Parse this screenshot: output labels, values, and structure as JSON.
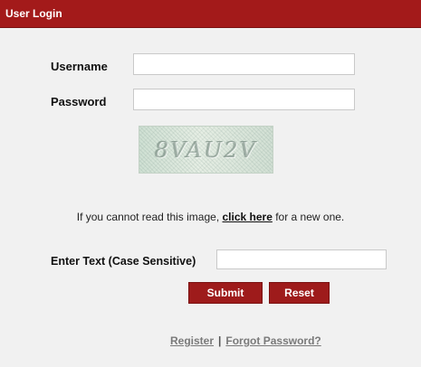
{
  "header": {
    "title": "User Login"
  },
  "form": {
    "username_label": "Username",
    "username_value": "",
    "password_label": "Password",
    "password_value": ""
  },
  "captcha": {
    "image_text": "8VAU2V",
    "note_prefix": "If you cannot read this image, ",
    "note_link": "click here",
    "note_suffix": " for a new one.",
    "enter_label": "Enter Text (Case Sensitive)",
    "enter_value": ""
  },
  "buttons": {
    "submit": "Submit",
    "reset": "Reset"
  },
  "links": {
    "register": "Register",
    "separator": "|",
    "forgot": "Forgot Password?"
  },
  "colors": {
    "accent": "#a31a1a",
    "panel_bg": "#f1f1f1"
  }
}
